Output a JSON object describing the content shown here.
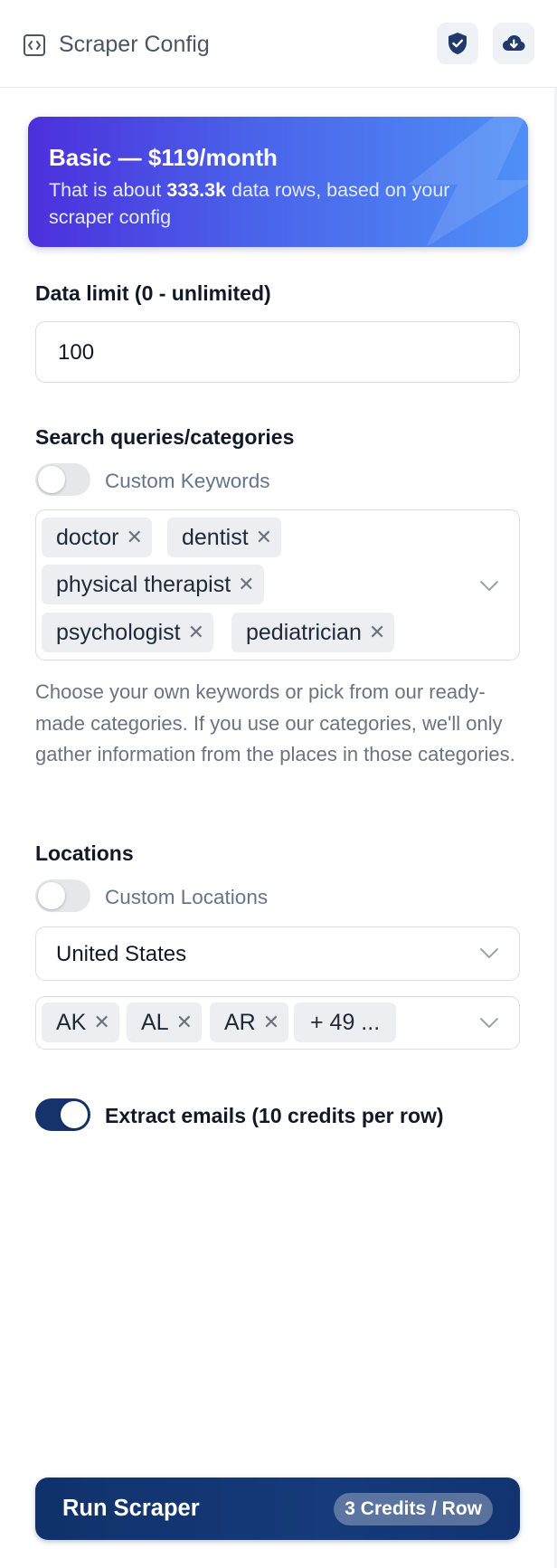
{
  "header": {
    "title": "Scraper Config",
    "icons": [
      "code-icon",
      "shield-check-icon",
      "cloud-download-icon"
    ]
  },
  "banner": {
    "title": "Basic — $119/month",
    "sub_prefix": "That is about ",
    "sub_bold": "333.3k",
    "sub_suffix": " data rows, based on your scraper config",
    "gradient_start": "#4c2fdc",
    "gradient_end": "#4f8ff6"
  },
  "data_limit": {
    "label": "Data limit (0 - unlimited)",
    "value": "100"
  },
  "queries": {
    "label": "Search queries/categories",
    "toggle_label": "Custom Keywords",
    "toggle_on": false,
    "tags": [
      "doctor",
      "dentist",
      "physical therapist",
      "psychologist",
      "pediatrician"
    ],
    "help": "Choose your own keywords or pick from our ready-made categories. If you use our categories, we'll only gather information from the places in those categories."
  },
  "locations": {
    "label": "Locations",
    "toggle_label": "Custom Locations",
    "toggle_on": false,
    "country": "United States",
    "states": [
      "AK",
      "AL",
      "AR"
    ],
    "more": "+ 49 ..."
  },
  "extract_emails": {
    "label": "Extract emails (10 credits per row)",
    "toggle_on": true
  },
  "run": {
    "label": "Run Scraper",
    "credits": "3 Credits / Row",
    "color": "#10316b"
  }
}
